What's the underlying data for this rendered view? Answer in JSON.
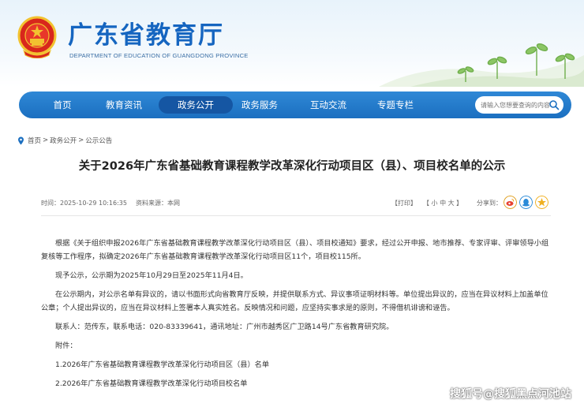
{
  "header": {
    "title": "广东省教育厅",
    "subtitle": "DEPARTMENT OF EDUCATION OF GUANGDONG PROVINCE"
  },
  "nav": {
    "items": [
      {
        "label": "首页"
      },
      {
        "label": "教育资讯"
      },
      {
        "label": "政务公开"
      },
      {
        "label": "政务服务"
      },
      {
        "label": "互动交流"
      },
      {
        "label": "专题专栏"
      }
    ],
    "active_index": 2,
    "search_placeholder": "请输入您想要查询的内容"
  },
  "breadcrumb": [
    "首页",
    ">",
    "政务公开",
    ">",
    "公示公告"
  ],
  "article": {
    "title": "关于2026年广东省基础教育课程教学改革深化行动项目区（县）、项目校名单的公示",
    "time": "时间：2025-10-29 10:16:35",
    "source": "资料来源：本网",
    "print": "【打印】",
    "font_size": "【 小  中  大 】",
    "share_label": "分享到：",
    "paragraphs": [
      "根据《关于组织申报2026年广东省基础教育课程教学改革深化行动项目区（县）、项目校通知》要求，经过公开申报、地市推荐、专家评审、评审领导小组复核等工作程序，拟确定2026年广东省基础教育课程教学改革深化行动项目区11个，项目校115所。",
      "现予公示，公示期为2025年10月29日至2025年11月4日。",
      "在公示期内，对公示名单有异议的，请以书面形式向省教育厅反映，并提供联系方式、异议事项证明材料等。单位提出异议的，应当在异议材料上加盖单位公章；个人提出异议的，应当在异议材料上签署本人真实姓名。反映情况和问题，应坚持实事求是的原则，不得借机诽谤和诬告。",
      "联系人：范传东，联系电话：020-83339641，通讯地址：广州市越秀区广卫路14号广东省教育研究院。",
      "附件：",
      "1.2026年广东省基础教育课程教学改革深化行动项目区（县）名单",
      "2.2026年广东省基础教育课程教学改革深化行动项目校名单"
    ]
  },
  "watermark": "搜狐号@搜狐黑点河池站",
  "colors": {
    "brand_blue": "#1565c0",
    "nav_blue": "#2f88d6",
    "nav_active": "#1556a3"
  }
}
